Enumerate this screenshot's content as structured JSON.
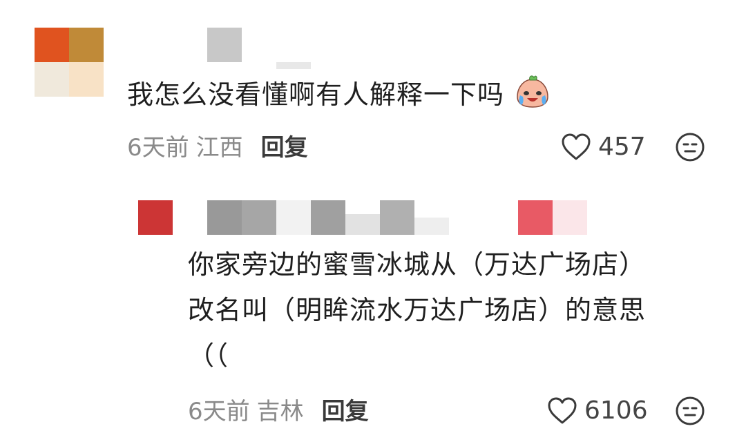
{
  "comments": [
    {
      "text": "我怎么没看懂啊有人解释一下吗",
      "emoji": "crying-laughing-peach-emoji",
      "time": "6天前",
      "region": "江西",
      "reply_label": "回复",
      "likes": "457"
    },
    {
      "text_lines": [
        "你家旁边的蜜雪冰城从（万达广场店）",
        "改名叫（明眸流水万达广场店）的意思",
        "（（"
      ],
      "time": "6天前",
      "region": "吉林",
      "reply_label": "回复",
      "likes": "6106"
    }
  ],
  "colors": {
    "text": "#1f1f1f",
    "meta": "#8a8a8a",
    "reply": "#3a3a3a"
  },
  "icons": [
    "heart-icon",
    "dislike-face-icon"
  ]
}
